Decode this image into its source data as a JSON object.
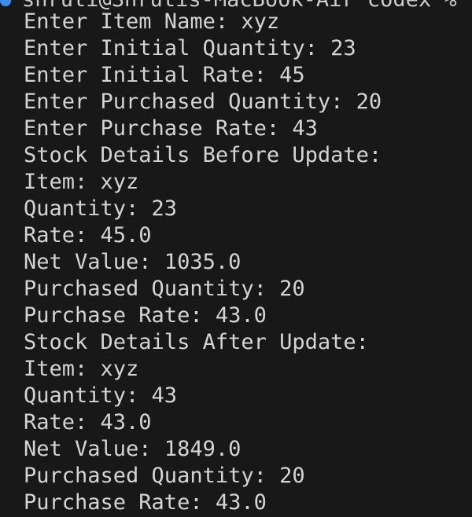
{
  "prompt": {
    "text": "shruti@Shrutis-MacBook-Air codex %"
  },
  "output_lines": [
    "Enter Item Name: xyz",
    "Enter Initial Quantity: 23",
    "Enter Initial Rate: 45",
    "Enter Purchased Quantity: 20",
    "Enter Purchase Rate: 43",
    "Stock Details Before Update:",
    "Item: xyz",
    "Quantity: 23",
    "Rate: 45.0",
    "Net Value: 1035.0",
    "Purchased Quantity: 20",
    "Purchase Rate: 43.0",
    "Stock Details After Update:",
    "Item: xyz",
    "Quantity: 43",
    "Rate: 43.0",
    "Net Value: 1849.0",
    "Purchased Quantity: 20",
    "Purchase Rate: 43.0"
  ]
}
